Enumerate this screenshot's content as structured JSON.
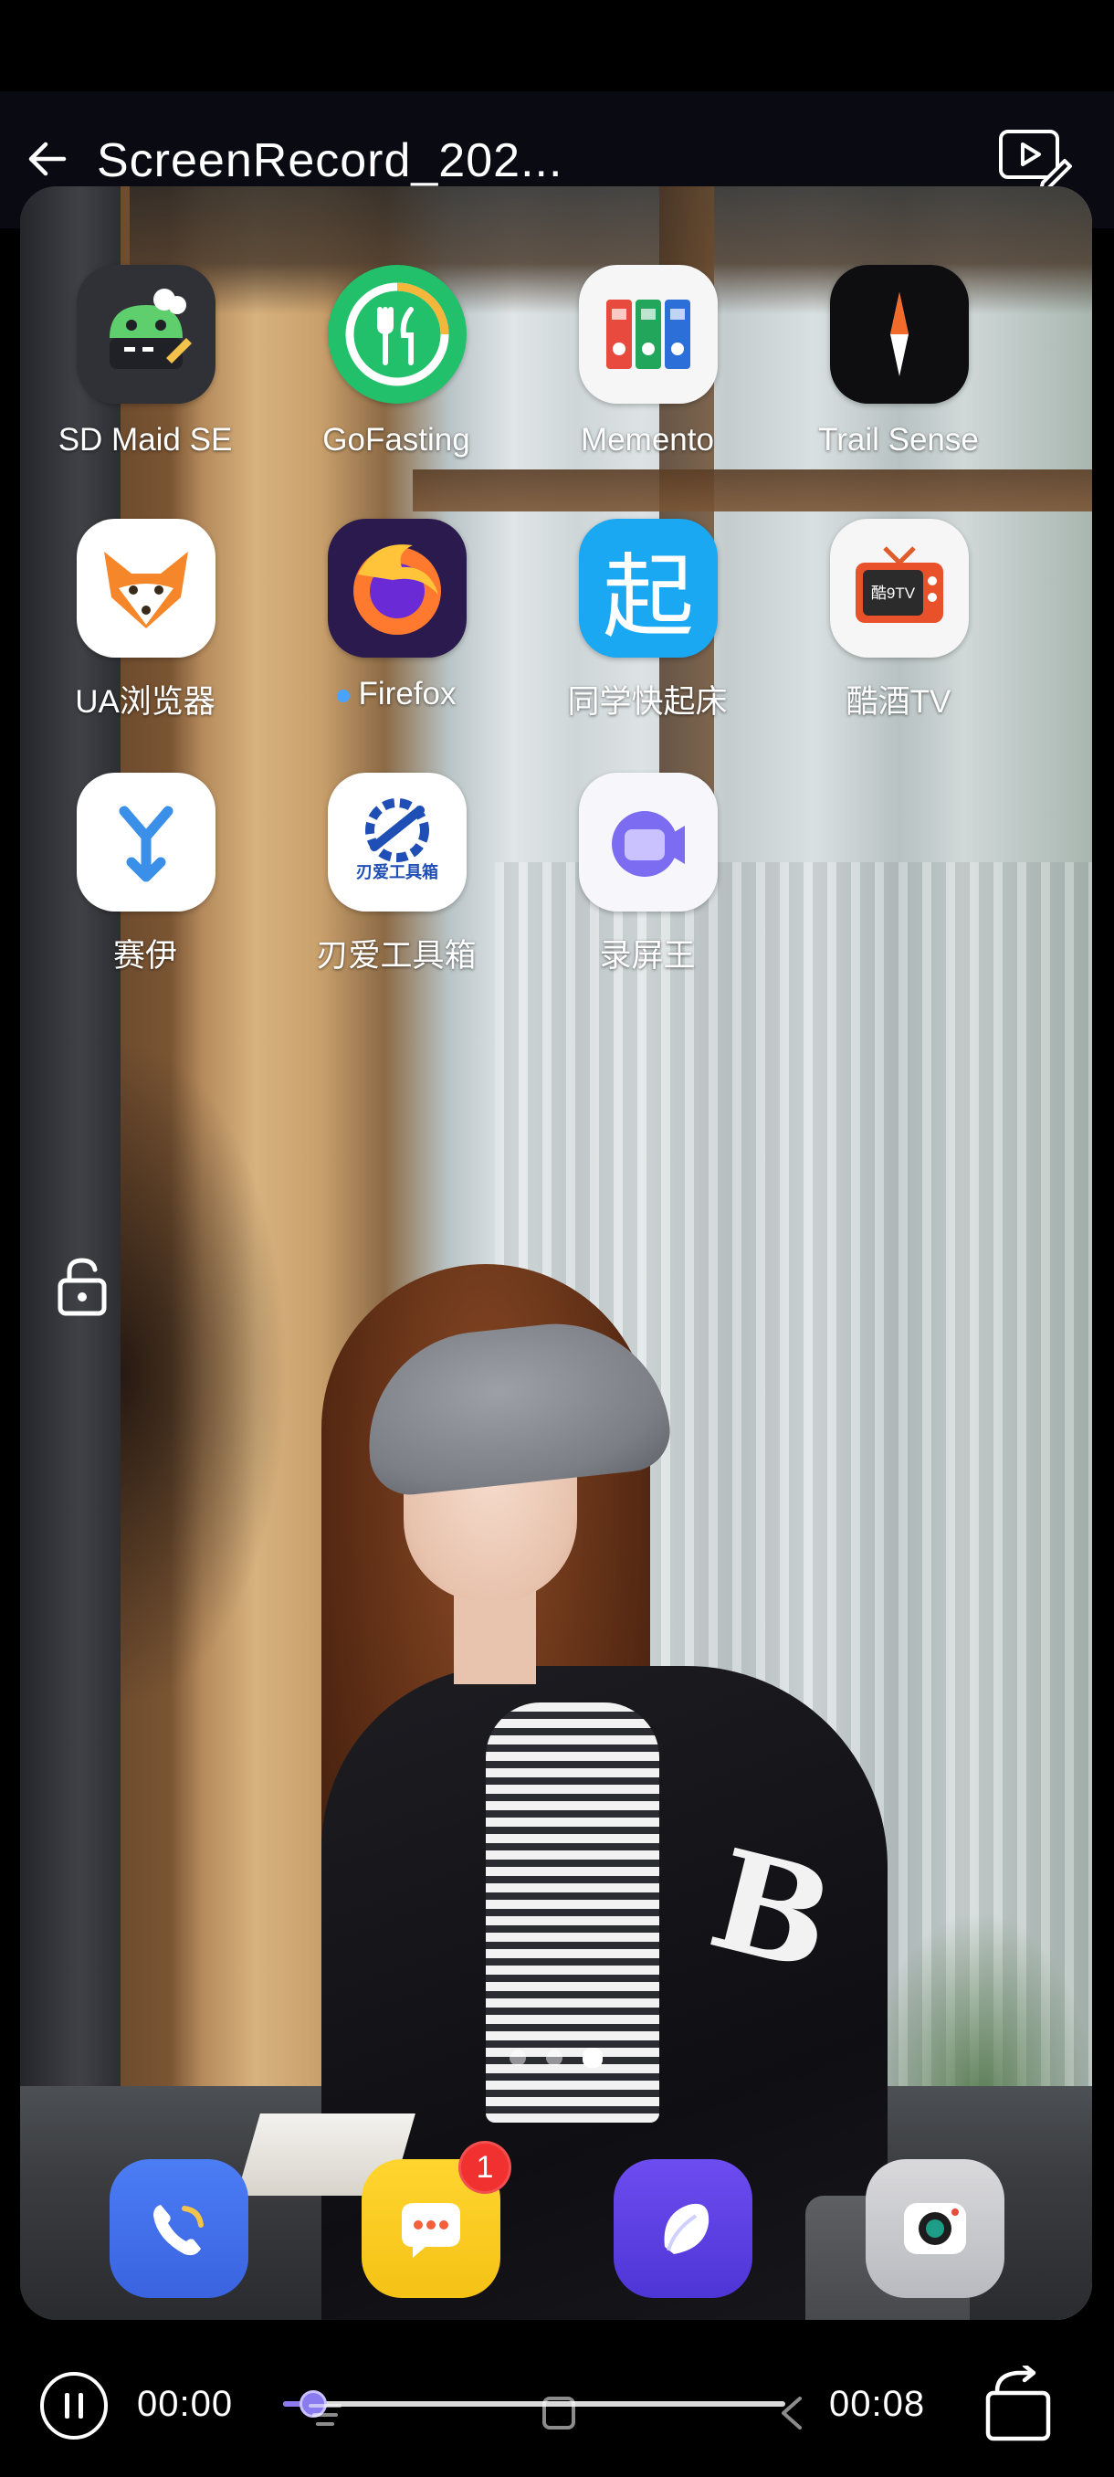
{
  "header": {
    "title": "ScreenRecord_202..."
  },
  "home_screen": {
    "apps": [
      {
        "label": "SD Maid SE",
        "icon": "sd-maid-icon"
      },
      {
        "label": "GoFasting",
        "icon": "gofasting-icon"
      },
      {
        "label": "Memento",
        "icon": "memento-icon"
      },
      {
        "label": "Trail Sense",
        "icon": "trail-sense-icon"
      },
      {
        "label": "UA浏览器",
        "icon": "ua-browser-icon"
      },
      {
        "label": "Firefox",
        "icon": "firefox-icon"
      },
      {
        "label": "同学快起床",
        "icon": "qi-icon",
        "glyph": "起"
      },
      {
        "label": "酷酒TV",
        "icon": "tv-icon",
        "glyph": "酷9TV"
      },
      {
        "label": "赛伊",
        "icon": "saiyi-icon"
      },
      {
        "label": "刃爱工具箱",
        "icon": "toolbox-icon",
        "glyph": "刃爱工具箱"
      },
      {
        "label": "录屏王",
        "icon": "screen-recorder-icon"
      }
    ],
    "page_indicator": {
      "count": 3,
      "active": 3
    },
    "dock": [
      {
        "icon": "phone-icon"
      },
      {
        "icon": "messages-icon",
        "badge": "1"
      },
      {
        "icon": "browser-icon"
      },
      {
        "icon": "camera-icon"
      }
    ]
  },
  "player": {
    "current_time": "00:00",
    "total_time": "00:08",
    "progress": 0.06
  },
  "colors": {
    "accent": "#8a7cf0",
    "badge": "#f1312f"
  }
}
